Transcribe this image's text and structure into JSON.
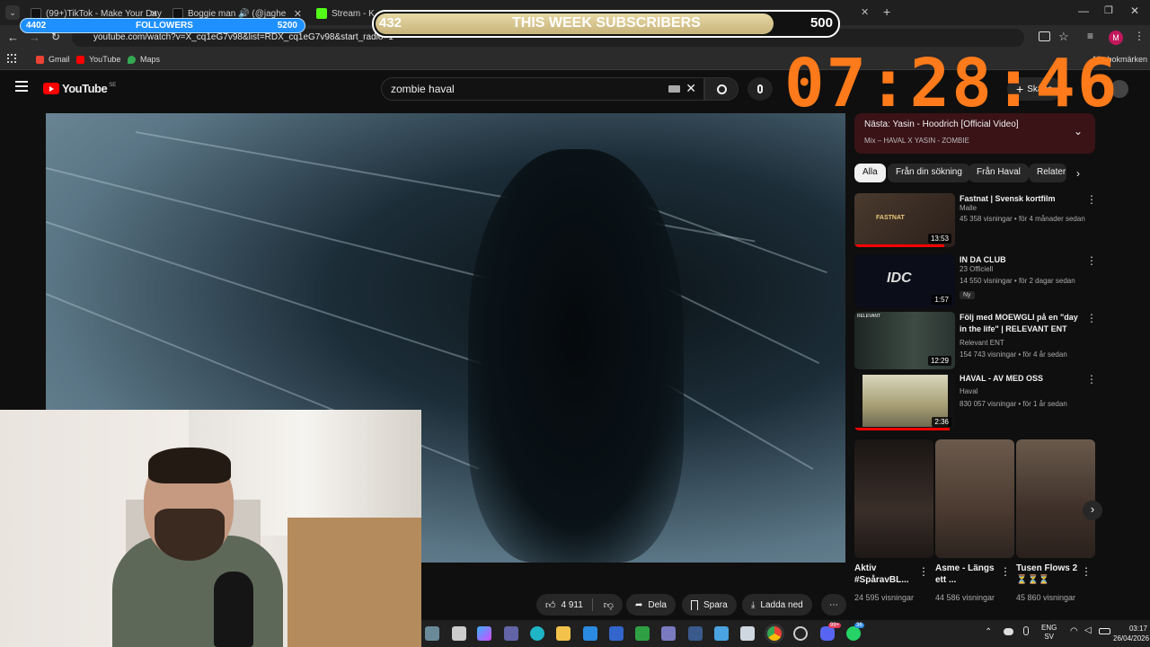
{
  "browser": {
    "tabs": [
      {
        "title": "(99+)TikTok - Make Your Day",
        "color": "#111111"
      },
      {
        "title": "Boggie man 🔊 (@jaghe",
        "color": "#111111"
      },
      {
        "title": "Stream - Kick D",
        "color": "#53fc18"
      }
    ],
    "url": "youtube.com/watch?v=X_cq1eG7v98&list=RDX_cq1eG7v98&start_radio=1",
    "bookmarks": [
      {
        "label": "Gmail",
        "color": "#ea4335"
      },
      {
        "label": "YouTube",
        "color": "#ff0000"
      },
      {
        "label": "Maps",
        "color": "#34a853"
      }
    ],
    "bookmarks_right": "Alla bokmärken"
  },
  "overlays": {
    "followers": {
      "current": "4402",
      "label": "FOLLOWERS",
      "goal": "5200",
      "progress": 0.846
    },
    "subscribers": {
      "current": "432",
      "label": "THIS WEEK SUBSCRIBERS",
      "goal": "500",
      "progress": 0.864
    },
    "clock": "07:28:46"
  },
  "youtube": {
    "logo": "YouTube",
    "region": "SE",
    "search_value": "zombie haval",
    "create_label": "Skapa",
    "actions": {
      "like_count": "4 911",
      "share": "Dela",
      "save": "Spara",
      "download": "Ladda ned"
    },
    "next_up": {
      "title": "Nästa: Yasin - Hoodrich [Official Video]",
      "subtitle": "Mix – HAVAL X YASIN - ZOMBIE"
    },
    "chips": [
      "Alla",
      "Från din sökning",
      "Från Haval",
      "Relater"
    ],
    "recommendations": [
      {
        "title": "Fastnat | Svensk kortfilm",
        "channel": "Malle",
        "meta": "45 358 visningar • för 4 månader sedan",
        "duration": "13:53",
        "progress": 0.9,
        "thumb": "#3a2c24",
        "thumb_text": "FASTNAT"
      },
      {
        "title": "IN DA CLUB",
        "channel": "23 Officiell",
        "meta": "14 550 visningar • för 2 dagar sedan",
        "duration": "1:57",
        "badge": "Ny",
        "progress": 0,
        "thumb": "#0b0d18",
        "thumb_text": "IDC"
      },
      {
        "title": "Följ med MOEWGLI på en \"day in the life\" | RELEVANT ENT",
        "channel": "Relevant ENT",
        "meta": "154 743 visningar • för 4 år sedan",
        "duration": "12:29",
        "progress": 0,
        "thumb": "#2d3a35",
        "thumb_text": "RELEVANT"
      },
      {
        "title": "HAVAL - AV MED OSS",
        "channel": "Haval",
        "meta": "830 057 visningar • för 1 år sedan",
        "duration": "2:36",
        "progress": 0.95,
        "thumb": "#b7b08a",
        "thumb_text": ""
      }
    ],
    "shorts": [
      {
        "title": "Aktiv #SpåravBL...",
        "views": "24 595 visningar",
        "color": "#2a2320"
      },
      {
        "title": "Asme - Längs ett ...",
        "views": "44 586 visningar",
        "color": "#5a4a3e"
      },
      {
        "title": "Tusen Flows 2⏳⏳⏳",
        "views": "45 860 visningar",
        "color": "#4d3e35"
      }
    ]
  },
  "taskbar": {
    "lang": "ENG",
    "lang_sub": "SV",
    "time": "03:17",
    "date": "26/04/2026",
    "badge_one": "99+",
    "badge_two": "36"
  }
}
